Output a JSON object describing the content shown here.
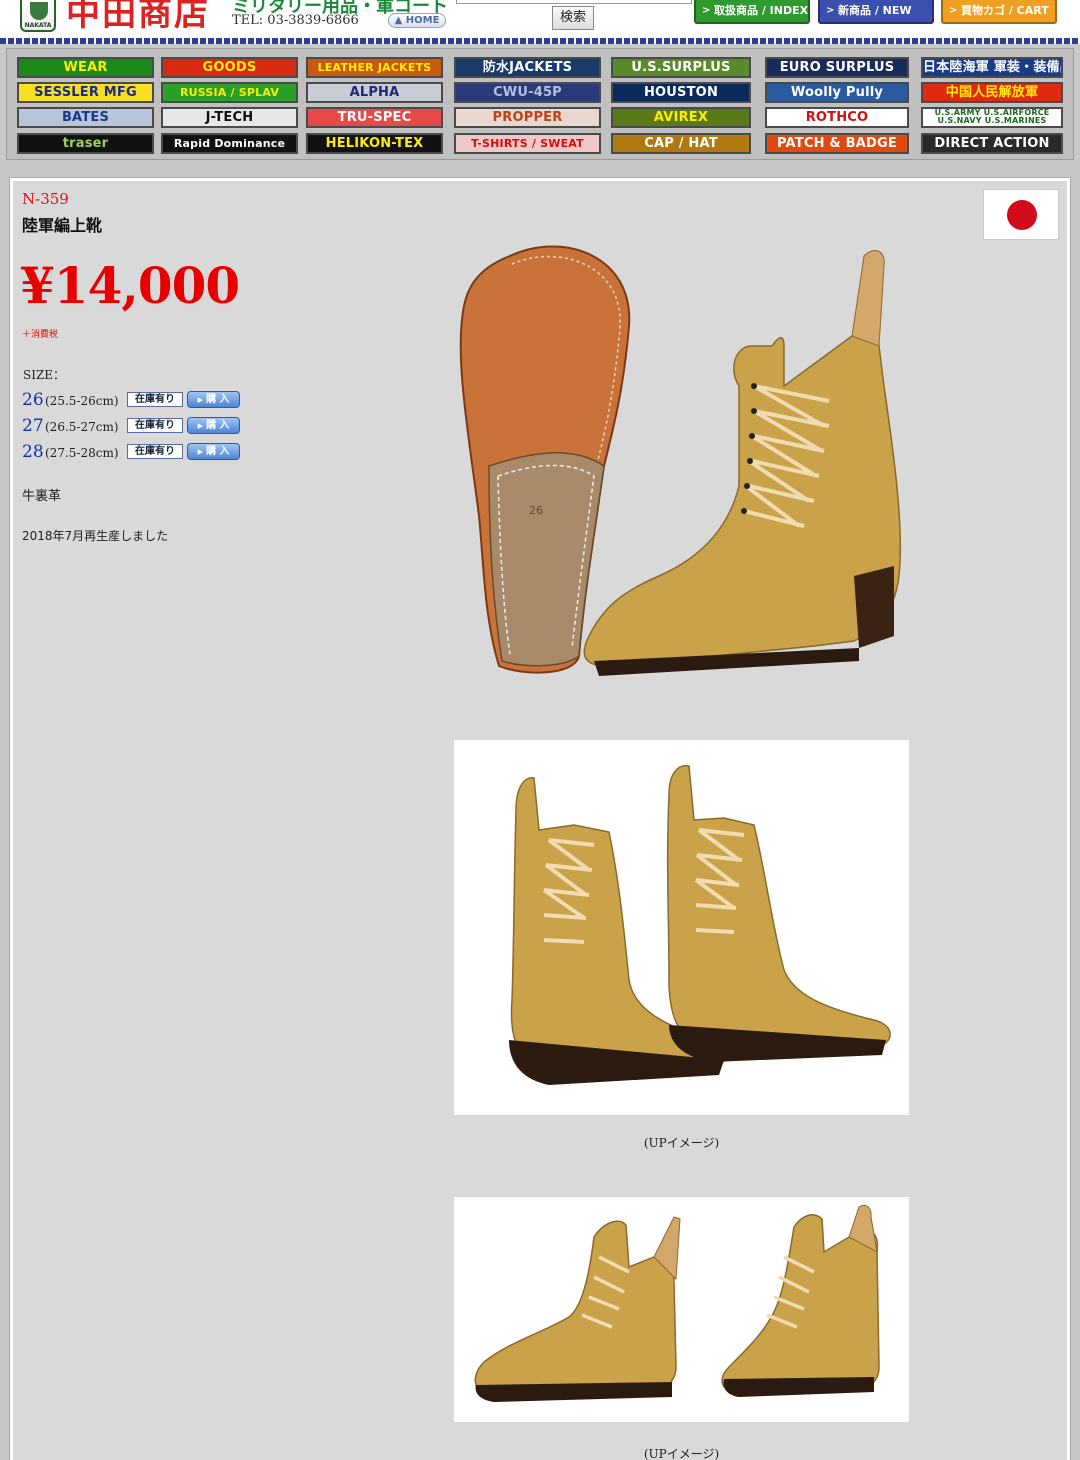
{
  "header": {
    "logo_text": "NAKATA",
    "shop_name": "中田商店",
    "tagline": "ミリタリー用品・軍コート",
    "tel": "TEL: 03-3839-6866",
    "home_label": "HOME",
    "search_button": "検索",
    "index_label": "取扱商品 / INDEX",
    "new_label": "新商品 / NEW",
    "cart_label": "買物カゴ / CART"
  },
  "categories": [
    {
      "label": "WEAR",
      "bg": "#1a8a1a",
      "fg": "#ffee00"
    },
    {
      "label": "GOODS",
      "bg": "#d82a10",
      "fg": "#ffee00"
    },
    {
      "label": "LEATHER JACKETS",
      "bg": "#c85a10",
      "fg": "#ffee00"
    },
    {
      "label": "防水JACKETS",
      "bg": "#1a3a6a",
      "fg": "#ffffff"
    },
    {
      "label": "U.S.SURPLUS",
      "bg": "#5a8a2a",
      "fg": "#ffffff"
    },
    {
      "label": "EURO SURPLUS",
      "bg": "#1a2a5a",
      "fg": "#ffffff"
    },
    {
      "label": "日本陸海軍 軍装・装備品",
      "bg": "#1a3a8a",
      "fg": "#ffffff"
    },
    {
      "label": "SESSLER MFG",
      "bg": "#f4e020",
      "fg": "#1a2a8a"
    },
    {
      "label": "RUSSIA / SPLAV",
      "bg": "#2aa02a",
      "fg": "#ffee00"
    },
    {
      "label": "ALPHA",
      "bg": "#c8ccd4",
      "fg": "#1a2a7a"
    },
    {
      "label": "CWU-45P",
      "bg": "#2a3a7a",
      "fg": "#b0c0e0"
    },
    {
      "label": "HOUSTON",
      "bg": "#0a2a5a",
      "fg": "#ffffff"
    },
    {
      "label": "Woolly Pully",
      "bg": "#2a5aa0",
      "fg": "#ffffff"
    },
    {
      "label": "中国人民解放軍",
      "bg": "#e02a10",
      "fg": "#ffee00"
    },
    {
      "label": "BATES",
      "bg": "#b8c4d8",
      "fg": "#1a3a8a"
    },
    {
      "label": "J-TECH",
      "bg": "#e8e8e8",
      "fg": "#111111"
    },
    {
      "label": "TRU-SPEC",
      "bg": "#e84a4a",
      "fg": "#ffffff"
    },
    {
      "label": "PROPPER",
      "bg": "#e8d8d0",
      "fg": "#c0401a"
    },
    {
      "label": "AVIREX",
      "bg": "#5a7a1a",
      "fg": "#ffee00"
    },
    {
      "label": "ROTHCO",
      "bg": "#ffffff",
      "fg": "#d01010"
    },
    {
      "label": "U.S.ARMY U.S.AIRFORCE U.S.NAVY U.S.MARINES",
      "bg": "#ffffff",
      "fg": "#1a6a1a"
    },
    {
      "label": "traser",
      "bg": "#111111",
      "fg": "#a0d060"
    },
    {
      "label": "Rapid Dominance",
      "bg": "#111111",
      "fg": "#ffffff"
    },
    {
      "label": "HELIKON-TEX",
      "bg": "#111111",
      "fg": "#ffee00"
    },
    {
      "label": "T-SHIRTS / SWEAT",
      "bg": "#f0c8c8",
      "fg": "#d01010"
    },
    {
      "label": "CAP / HAT",
      "bg": "#b07a10",
      "fg": "#ffffff"
    },
    {
      "label": "PATCH & BADGE",
      "bg": "#e04a10",
      "fg": "#ffffff"
    },
    {
      "label": "DIRECT ACTION",
      "bg": "#2a2a2a",
      "fg": "#ffffff"
    }
  ],
  "product": {
    "code": "N-359",
    "name": "陸軍編上靴",
    "price": "¥14,000",
    "tax_note": "＋消費税",
    "size_label": "SIZE：",
    "sizes": [
      {
        "num": "26",
        "range": "(25.5-26cm)",
        "stock": "在庫有り",
        "buy": "購 入"
      },
      {
        "num": "27",
        "range": "(26.5-27cm)",
        "stock": "在庫有り",
        "buy": "購 入"
      },
      {
        "num": "28",
        "range": "(27.5-28cm)",
        "stock": "在庫有り",
        "buy": "購 入"
      }
    ],
    "material": "牛裏革",
    "note": "2018年7月再生産しました",
    "sole_size_mark": "26",
    "caption1": "(UPイメージ)",
    "caption2": "(UPイメージ)"
  },
  "colors": {
    "price": "#e80000",
    "boot_suede": "#c9a24a",
    "sole_leather": "#c9733a"
  }
}
